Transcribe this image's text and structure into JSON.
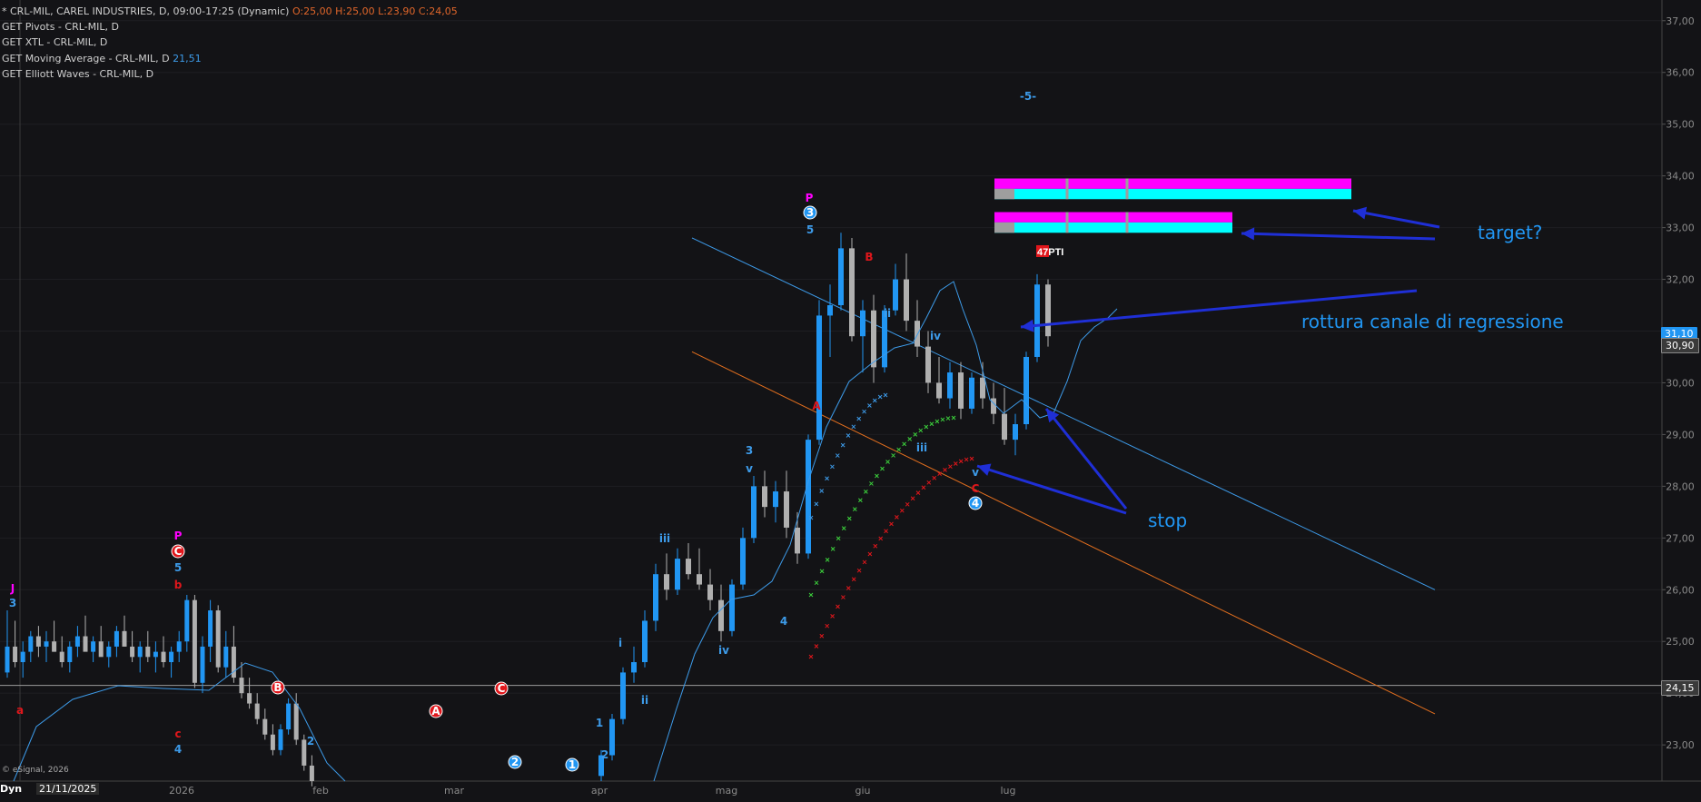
{
  "header": {
    "line1_prefix": "* CRL-MIL, CAREL INDUSTRIES, D, 09:00-17:25 (Dynamic)",
    "line1_ohlc": "O:25,00 H:25,00 L:23,90 C:24,05",
    "line2": "GET Pivots - CRL-MIL, D",
    "line3": "GET XTL - CRL-MIL, D",
    "line4_prefix": "GET Moving Average - CRL-MIL, D",
    "line4_value": "21,51",
    "line5": "GET Elliott Waves - CRL-MIL, D"
  },
  "annotations": {
    "target": "target?",
    "rottura": "rottura canale di regressione",
    "stop": "stop"
  },
  "price_badges": {
    "current": "30,90",
    "current_behind": "31,10",
    "ref_line": "24,15"
  },
  "footer": {
    "copyright": "© eSignal, 2026",
    "mode": "Dyn",
    "date": "21/11/2025"
  },
  "pti_label": "47PTI",
  "colors": {
    "background": "#131316",
    "up_candle": "#2196f3",
    "down_candle": "#b0b0b0",
    "red_candle": "#e0161b",
    "ma": "#3d9be9",
    "channel_upper": "#3d9be9",
    "channel_lower": "#e36f1e",
    "xtl_green": "#3cd13c",
    "xtl_red": "#e0161b",
    "xtl_blue": "#3d9be9",
    "target_magenta": "#ff00ff",
    "target_cyan": "#00ffff",
    "arrow": "#1f2fd6",
    "wave_blue": "#3d9be9",
    "wave_red": "#e0161b",
    "wave_magenta": "#ff00ff"
  },
  "chart_data": {
    "type": "candlestick",
    "symbol": "CRL-MIL",
    "y_ticks": [
      "37,00",
      "36,00",
      "35,00",
      "34,00",
      "33,00",
      "32,00",
      "31,00",
      "30,00",
      "29,00",
      "28,00",
      "27,00",
      "26,00",
      "25,00",
      "24,00",
      "23,00"
    ],
    "ylim": [
      22.3,
      37.4
    ],
    "x_ticks": [
      "2026",
      "feb",
      "mar",
      "apr",
      "mag",
      "giu",
      "lug"
    ],
    "candles": [
      [
        24.4,
        25.6,
        24.3,
        24.9
      ],
      [
        24.9,
        25.4,
        24.5,
        24.6
      ],
      [
        24.6,
        25.0,
        24.3,
        24.8
      ],
      [
        24.8,
        25.2,
        24.6,
        25.1
      ],
      [
        25.1,
        25.3,
        24.7,
        24.9
      ],
      [
        24.9,
        25.2,
        24.6,
        25.0
      ],
      [
        25.0,
        25.4,
        24.8,
        24.8
      ],
      [
        24.8,
        25.1,
        24.5,
        24.6
      ],
      [
        24.6,
        25.0,
        24.4,
        24.9
      ],
      [
        24.9,
        25.3,
        24.7,
        25.1
      ],
      [
        25.1,
        25.5,
        24.9,
        24.8
      ],
      [
        24.8,
        25.1,
        24.6,
        25.0
      ],
      [
        25.0,
        25.3,
        24.8,
        24.7
      ],
      [
        24.7,
        25.0,
        24.5,
        24.9
      ],
      [
        24.9,
        25.3,
        24.7,
        25.2
      ],
      [
        25.2,
        25.5,
        24.9,
        24.9
      ],
      [
        24.9,
        25.2,
        24.6,
        24.7
      ],
      [
        24.7,
        25.0,
        24.4,
        24.9
      ],
      [
        24.9,
        25.2,
        24.6,
        24.7
      ],
      [
        24.7,
        25.0,
        24.4,
        24.8
      ],
      [
        24.8,
        25.1,
        24.5,
        24.6
      ],
      [
        24.6,
        24.9,
        24.3,
        24.8
      ],
      [
        24.8,
        25.2,
        24.6,
        25.0
      ],
      [
        25.0,
        25.9,
        24.8,
        25.8
      ],
      [
        25.8,
        25.9,
        24.1,
        24.2
      ],
      [
        24.2,
        25.1,
        24.0,
        24.9
      ],
      [
        24.9,
        25.8,
        24.6,
        25.6
      ],
      [
        25.6,
        25.7,
        24.4,
        24.5
      ],
      [
        24.5,
        25.2,
        24.3,
        24.9
      ],
      [
        24.9,
        25.3,
        24.2,
        24.3
      ],
      [
        24.3,
        24.6,
        23.9,
        24.0
      ],
      [
        24.0,
        24.3,
        23.7,
        23.8
      ],
      [
        23.8,
        24.0,
        23.4,
        23.5
      ],
      [
        23.5,
        23.7,
        23.1,
        23.2
      ],
      [
        23.2,
        23.4,
        22.8,
        22.9
      ],
      [
        22.9,
        23.4,
        22.8,
        23.3
      ],
      [
        23.3,
        23.9,
        23.2,
        23.8
      ],
      [
        23.8,
        24.0,
        23.0,
        23.1
      ],
      [
        23.1,
        23.2,
        22.5,
        22.6
      ],
      [
        22.6,
        22.8,
        22.2,
        22.3
      ]
    ],
    "rally_candles": [
      [
        22.4,
        22.9,
        22.3,
        22.8
      ],
      [
        22.8,
        23.6,
        22.7,
        23.5
      ],
      [
        23.5,
        24.5,
        23.4,
        24.4
      ],
      [
        24.4,
        24.9,
        24.2,
        24.6
      ],
      [
        24.6,
        25.6,
        24.5,
        25.4
      ],
      [
        25.4,
        26.5,
        25.2,
        26.3
      ],
      [
        26.3,
        26.7,
        25.8,
        26.0
      ],
      [
        26.0,
        26.8,
        25.9,
        26.6
      ],
      [
        26.6,
        26.9,
        26.2,
        26.3
      ],
      [
        26.3,
        26.8,
        26.0,
        26.1
      ],
      [
        26.1,
        26.4,
        25.6,
        25.8
      ],
      [
        25.8,
        26.1,
        25.0,
        25.2
      ],
      [
        25.2,
        26.2,
        25.1,
        26.1
      ],
      [
        26.1,
        27.2,
        26.0,
        27.0
      ],
      [
        27.0,
        28.2,
        26.9,
        28.0
      ],
      [
        28.0,
        28.3,
        27.4,
        27.6
      ],
      [
        27.6,
        28.1,
        27.3,
        27.9
      ],
      [
        27.9,
        28.3,
        27.0,
        27.2
      ],
      [
        27.2,
        27.5,
        26.5,
        26.7
      ],
      [
        26.7,
        29.0,
        26.6,
        28.9
      ],
      [
        28.9,
        31.6,
        28.8,
        31.3
      ],
      [
        31.3,
        31.9,
        30.5,
        31.5
      ],
      [
        31.5,
        32.9,
        31.4,
        32.6
      ],
      [
        32.6,
        32.8,
        30.8,
        30.9
      ],
      [
        30.9,
        31.6,
        30.2,
        31.4
      ],
      [
        31.4,
        31.7,
        30.0,
        30.3
      ],
      [
        30.3,
        31.5,
        30.2,
        31.4
      ],
      [
        31.4,
        32.3,
        31.3,
        32.0
      ],
      [
        32.0,
        32.5,
        31.0,
        31.2
      ],
      [
        31.2,
        31.6,
        30.5,
        30.7
      ],
      [
        30.7,
        31.0,
        29.8,
        30.0
      ],
      [
        30.0,
        30.5,
        29.6,
        29.7
      ],
      [
        29.7,
        30.4,
        29.5,
        30.2
      ],
      [
        30.2,
        30.4,
        29.3,
        29.5
      ],
      [
        29.5,
        30.2,
        29.4,
        30.1
      ],
      [
        30.1,
        30.4,
        29.5,
        29.7
      ],
      [
        29.7,
        30.0,
        29.2,
        29.4
      ],
      [
        29.4,
        29.9,
        28.8,
        28.9
      ],
      [
        28.9,
        29.4,
        28.6,
        29.2
      ],
      [
        29.2,
        30.6,
        29.1,
        30.5
      ],
      [
        30.5,
        32.1,
        30.4,
        31.9
      ],
      [
        31.9,
        32.0,
        30.7,
        30.9
      ]
    ],
    "moving_average_value": "21,51",
    "current_price": "30,90",
    "last_ohlc": {
      "open": "25,00",
      "high": "25,00",
      "low": "23,90",
      "close": "24,05"
    },
    "horizontal_line": 24.15,
    "regression_channel": {
      "upper": {
        "from": [
          762,
          32.8
        ],
        "to": [
          1580,
          26.0
        ]
      },
      "lower": {
        "from": [
          762,
          30.6
        ],
        "to": [
          1580,
          23.6
        ]
      }
    },
    "targets": [
      {
        "top": 33.95,
        "bottom": 33.55
      },
      {
        "top": 33.3,
        "bottom": 32.9
      }
    ],
    "wave_labels": [
      {
        "text": "J",
        "c": "magenta"
      },
      {
        "text": "3",
        "c": "blue"
      },
      {
        "text": "a",
        "c": "red"
      },
      {
        "text": "P",
        "c": "magenta"
      },
      {
        "text": "C",
        "c": "redcircle"
      },
      {
        "text": "5",
        "c": "blue"
      },
      {
        "text": "b",
        "c": "red"
      },
      {
        "text": "c",
        "c": "red"
      },
      {
        "text": "4",
        "c": "blue"
      },
      {
        "text": "B",
        "c": "redcircle"
      },
      {
        "text": "2",
        "c": "blue"
      },
      {
        "text": "A",
        "c": "redcircle"
      },
      {
        "text": "C",
        "c": "redcircle"
      },
      {
        "text": "2",
        "c": "bluecircle"
      },
      {
        "text": "1",
        "c": "bluecircle"
      },
      {
        "text": "1",
        "c": "blue"
      },
      {
        "text": "2",
        "c": "blue"
      },
      {
        "text": "i",
        "c": "blue"
      },
      {
        "text": "ii",
        "c": "blue"
      },
      {
        "text": "iii",
        "c": "blue"
      },
      {
        "text": "iv",
        "c": "blue"
      },
      {
        "text": "3",
        "c": "blue"
      },
      {
        "text": "v",
        "c": "blue"
      },
      {
        "text": "4",
        "c": "blue"
      },
      {
        "text": "P",
        "c": "magenta"
      },
      {
        "text": "3",
        "c": "bluecircle"
      },
      {
        "text": "5",
        "c": "blue"
      },
      {
        "text": "A",
        "c": "red"
      },
      {
        "text": "B",
        "c": "red"
      },
      {
        "text": "ii",
        "c": "blue"
      },
      {
        "text": "iv",
        "c": "blue"
      },
      {
        "text": "iii",
        "c": "blue"
      },
      {
        "text": "v",
        "c": "blue"
      },
      {
        "text": "C",
        "c": "red"
      },
      {
        "text": "4",
        "c": "bluecircle"
      },
      {
        "text": "-5-",
        "c": "blue"
      }
    ]
  }
}
